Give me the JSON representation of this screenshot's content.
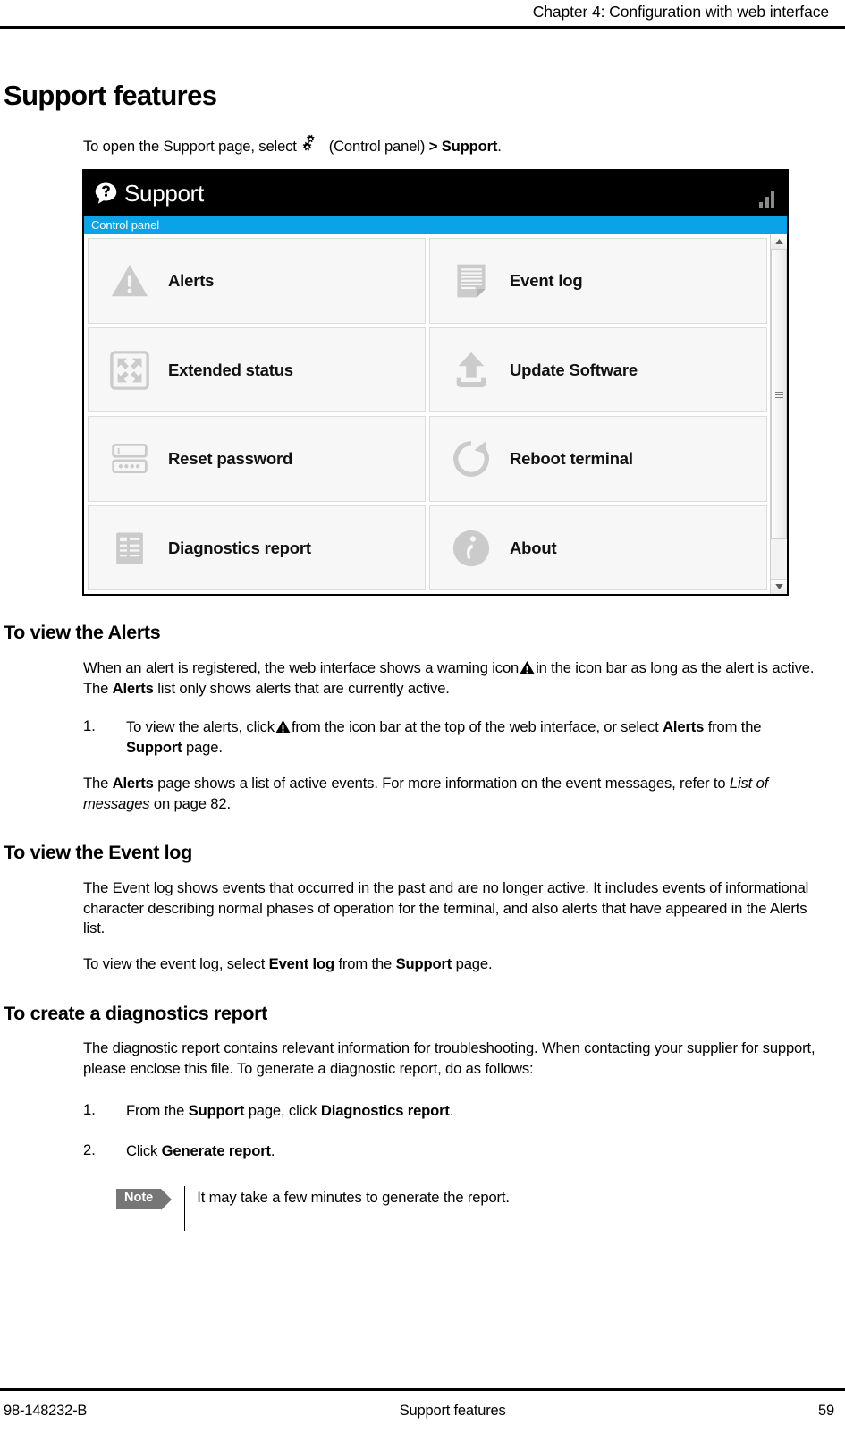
{
  "header": {
    "chapter_title": "Chapter 4: Configuration with web interface"
  },
  "main": {
    "section_title": "Support features",
    "intro": {
      "pre": "To open the Support page, select",
      "gear_icon": "gears-icon",
      "mid": "(Control panel)",
      "chevron": ">",
      "target": "Support",
      "period": "."
    },
    "screenshot": {
      "title": "Support",
      "title_icon": "help-bubble-icon",
      "signal_icon": "signal-strength-icon",
      "breadcrumb": "Control panel",
      "tiles": [
        {
          "label": "Alerts",
          "icon": "warning-triangle-icon"
        },
        {
          "label": "Event log",
          "icon": "document-lines-icon"
        },
        {
          "label": "Extended status",
          "icon": "expand-arrows-icon"
        },
        {
          "label": "Update Software",
          "icon": "upload-arrow-icon"
        },
        {
          "label": "Reset password",
          "icon": "password-fields-icon"
        },
        {
          "label": "Reboot terminal",
          "icon": "refresh-circle-icon"
        },
        {
          "label": "Diagnostics report",
          "icon": "report-lines-icon"
        },
        {
          "label": "About",
          "icon": "info-circle-icon"
        }
      ],
      "scrollbar": {
        "up_arrow": "▲",
        "down_arrow": "▼"
      }
    },
    "sections": [
      {
        "heading": "To view the Alerts",
        "paragraph1": {
          "a": "When an alert is registered, the web interface shows a warning icon",
          "icon": "warning-triangle-icon",
          "b": "in the icon bar as long as the alert is active. The",
          "bold1": "Alerts",
          "c": "list only shows alerts that are currently active."
        },
        "step1": {
          "num": "1.",
          "a": "To view the alerts, click",
          "icon": "warning-triangle-icon",
          "b": "from the icon bar at the top of the web interface, or select",
          "bold1": "Alerts",
          "c": "from the",
          "bold2": "Support",
          "d": "page."
        },
        "paragraph2": {
          "a": "The",
          "bold1": "Alerts",
          "b": "page shows a list of active events. For more information on the event messages, refer to",
          "italic1": "List of messages",
          "c": "on page 82."
        }
      },
      {
        "heading": "To view the Event log",
        "paragraph1": "The Event log shows events that occurred in the past and are no longer active. It includes events of informational character describing normal phases of operation for the terminal, and also alerts that have appeared in the Alerts list.",
        "paragraph2": {
          "a": "To view the event log, select",
          "bold1": "Event log",
          "b": "from the",
          "bold2": "Support",
          "c": "page."
        }
      },
      {
        "heading": "To create a diagnostics report",
        "paragraph1": "The diagnostic report contains relevant information for troubleshooting. When contacting your supplier for support, please enclose this file. To generate a diagnostic report, do as follows:",
        "step1": {
          "num": "1.",
          "a": "From the",
          "bold1": "Support",
          "b": "page, click",
          "bold2": "Diagnostics report",
          "c": "."
        },
        "step2": {
          "num": "2.",
          "a": "Click",
          "bold1": "Generate report",
          "b": "."
        },
        "note": {
          "badge": "Note",
          "text": "It may take a few minutes to generate the report."
        }
      }
    ]
  },
  "footer": {
    "doc_number": "98-148232-B",
    "center": "Support features",
    "page_number": "59"
  },
  "colors": {
    "breadcrumb_blue": "#0aa3e8",
    "titlebar_black": "#000000",
    "tile_bg": "#f7f7f7",
    "tile_icon_gray": "#cccccc",
    "note_badge_gray": "#767676"
  }
}
